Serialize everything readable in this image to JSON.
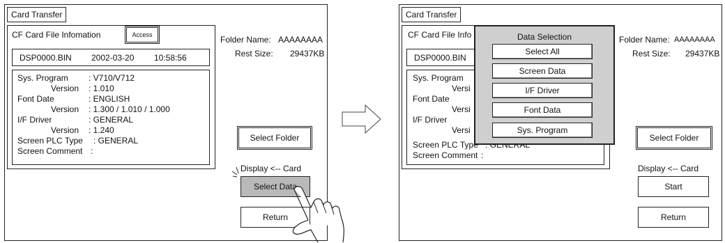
{
  "left": {
    "tab_title": "Card Transfer",
    "info_header": "CF Card File Infomation",
    "access_button": "Access",
    "file_name": "DSP0000.BIN",
    "file_date": "2002-03-20",
    "file_time": "10:58:56",
    "info_lines": [
      {
        "label": "Sys.  Program",
        "value": ": V710/V712"
      },
      {
        "label": "Version",
        "value": ": 1.010"
      },
      {
        "label": "Font Date",
        "value": ": ENGLISH"
      },
      {
        "label": "Version",
        "value": ": 1.300 / 1.010 / 1.000"
      },
      {
        "label": "I/F Driver",
        "value": ": GENERAL"
      },
      {
        "label": "Version",
        "value": ": 1.240"
      },
      {
        "label": "Screen PLC Type",
        "value": ": GENERAL"
      },
      {
        "label": "Screen Comment",
        "value": ":"
      }
    ],
    "folder_name_label": "Folder Name:",
    "folder_name_value": "AAAAAAAA",
    "rest_size_label": "Rest Size:",
    "rest_size_value": "29437KB",
    "select_folder_button": "Select Folder",
    "display_direction": "Display <-- Card",
    "select_data_button": "Select Data",
    "return_button": "Return"
  },
  "right": {
    "tab_title": "Card Transfer",
    "info_header": "CF Card File Info",
    "file_name": "DSP0000.BIN",
    "info_lines": [
      {
        "label": "Sys.  Program",
        "value": ""
      },
      {
        "label": "Versi",
        "value": ""
      },
      {
        "label": "Font Date",
        "value": ""
      },
      {
        "label": "Versi",
        "value": ""
      },
      {
        "label": "I/F Driver",
        "value": ""
      },
      {
        "label": "Versi",
        "value": ""
      },
      {
        "label": "Screen PLC Type",
        "value": ": GENERAL"
      },
      {
        "label": "Screen Comment",
        "value": ":"
      }
    ],
    "folder_name_label": "Folder Name:",
    "folder_name_value": "AAAAAAAA",
    "rest_size_label": "Rest Size:",
    "rest_size_value": "29437KB",
    "select_folder_button": "Select Folder",
    "display_direction": "Display <-- Card",
    "start_button": "Start",
    "return_button": "Return",
    "dialog": {
      "title": "Data Selection",
      "options": [
        "Select All",
        "Screen Data",
        "I/F Driver",
        "Font Data",
        "Sys.  Program"
      ]
    }
  },
  "icons": {
    "arrow": "right-arrow-icon",
    "hand": "pointing-hand-icon",
    "click": "click-spark-icon"
  }
}
